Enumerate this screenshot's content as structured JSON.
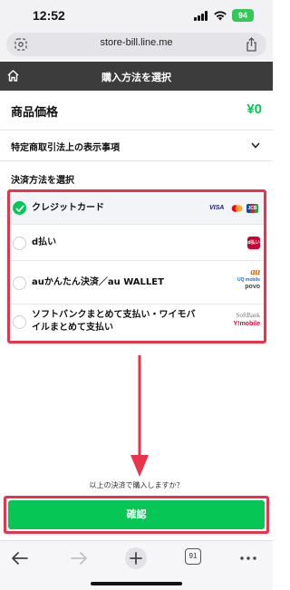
{
  "status_bar": {
    "time": "12:52",
    "battery": "94"
  },
  "browser": {
    "url": "store-bill.line.me",
    "tabs_count": "91"
  },
  "header": {
    "title": "購入方法を選択"
  },
  "price": {
    "label": "商品価格",
    "value": "¥0"
  },
  "legal": {
    "label": "特定商取引法上の表示事項"
  },
  "payment": {
    "heading": "決済方法を選択",
    "methods": [
      {
        "label": "クレジットカード",
        "selected": true,
        "logos": [
          "VISA",
          "Mastercard",
          "JCB"
        ]
      },
      {
        "label": "d払い",
        "selected": false,
        "logos": [
          "d払い"
        ]
      },
      {
        "label": "auかんたん決済／au WALLET",
        "selected": false,
        "logos": [
          "au",
          "UQ mobile",
          "povo"
        ]
      },
      {
        "label": "ソフトバンクまとめて支払い・ワイモバイルまとめて支払い",
        "selected": false,
        "logos": [
          "SoftBank",
          "Y!mobile"
        ]
      }
    ]
  },
  "confirm": {
    "question": "以上の決済で購入しますか？",
    "button_label": "確認"
  },
  "colors": {
    "accent_green": "#06c755",
    "highlight_red": "#e8334a",
    "header_bg": "#3c3c3c"
  },
  "icons": [
    "tracking-icon",
    "share-icon",
    "home-icon",
    "chevron-down-icon",
    "checkmark-icon",
    "back-arrow-icon",
    "forward-arrow-icon",
    "new-tab-plus-icon",
    "tabs-icon",
    "more-icon"
  ]
}
